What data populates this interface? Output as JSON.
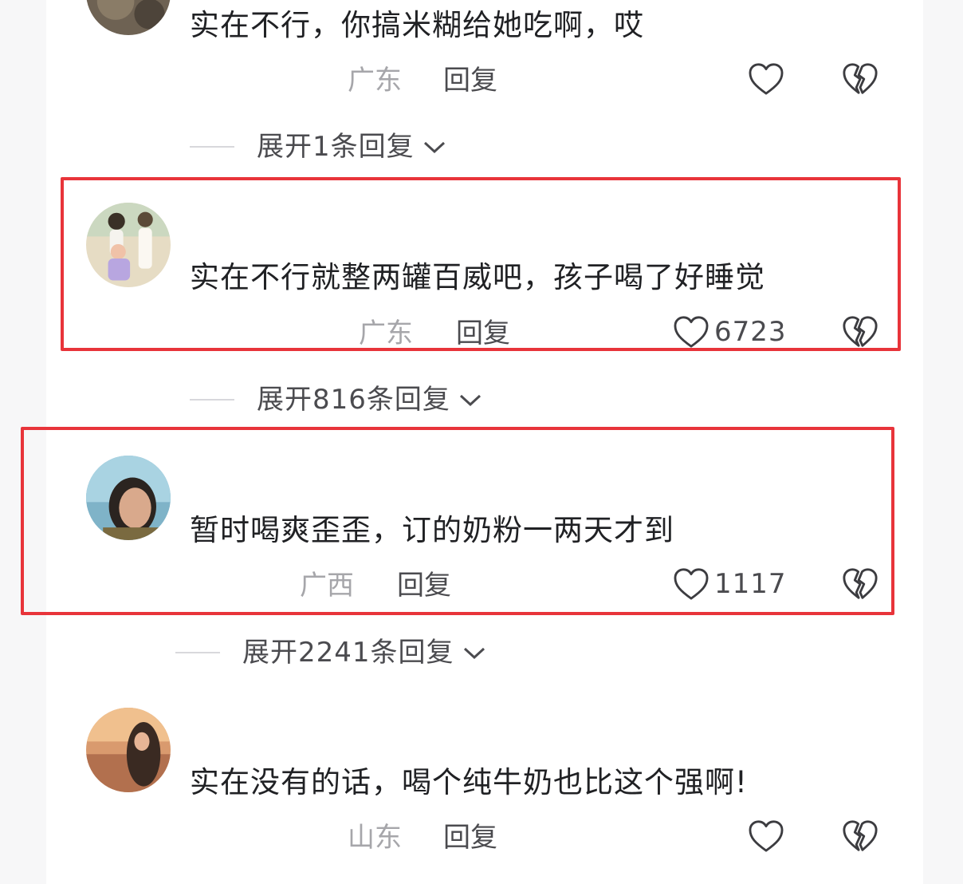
{
  "comments": [
    {
      "text": "实在不行，你搞米糊给她吃啊，哎",
      "location": "广东",
      "reply_label": "回复",
      "likes": "",
      "expand": {
        "label": "展开1条回复"
      }
    },
    {
      "text": "实在不行就整两罐百威吧，孩子喝了好睡觉",
      "location": "广东",
      "reply_label": "回复",
      "likes": "6723",
      "expand": {
        "label": "展开816条回复"
      }
    },
    {
      "text": "暂时喝爽歪歪，订的奶粉一两天才到",
      "location": "广西",
      "reply_label": "回复",
      "likes": "1117",
      "expand": {
        "label": "展开2241条回复"
      }
    },
    {
      "text": "实在没有的话，喝个纯牛奶也比这个强啊!",
      "location": "山东",
      "reply_label": "回复",
      "likes": ""
    }
  ],
  "colors": {
    "highlight_border": "#e8343a",
    "location_text": "#a6a6aa",
    "action_text": "#4b4b4f"
  },
  "icons": {
    "like": "heart-outline-icon",
    "dislike": "broken-heart-icon",
    "expand": "chevron-down-icon"
  }
}
